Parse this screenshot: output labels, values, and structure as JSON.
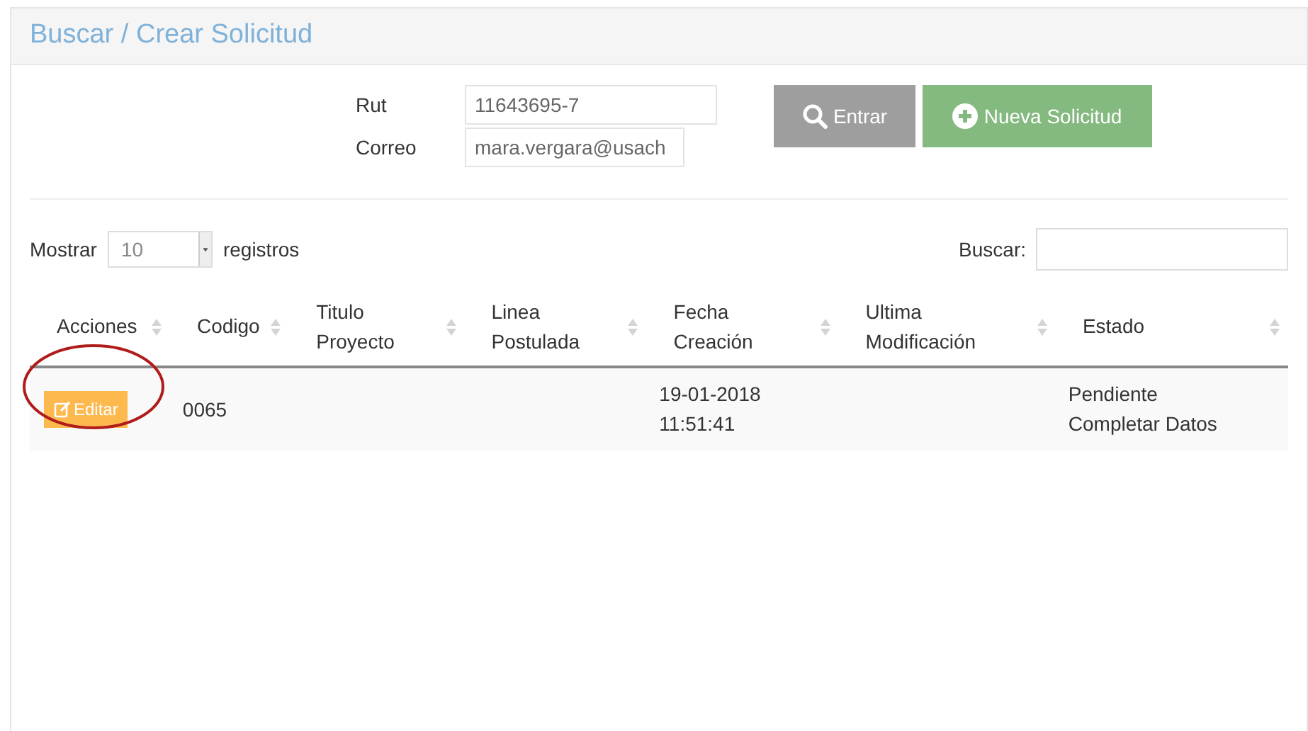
{
  "panel": {
    "title": "Buscar / Crear Solicitud"
  },
  "form": {
    "fields": [
      {
        "label": "Rut",
        "value": "11643695-7"
      },
      {
        "label": "Correo",
        "value": "mara.vergara@usach"
      }
    ],
    "buttons": [
      {
        "kind": "search",
        "label": "Entrar"
      },
      {
        "kind": "add",
        "label": "Nueva Solicitud"
      }
    ]
  },
  "table_controls": {
    "show_label": "Mostrar",
    "page_size": "10",
    "records_label": "registros",
    "search_label": "Buscar:"
  },
  "table": {
    "columns": [
      "Acciones",
      "Codigo",
      "Titulo Proyecto",
      "Linea Postulada",
      "Fecha Creación",
      "Ultima Modificación",
      "Estado"
    ],
    "rows": [
      {
        "highlighted": true,
        "cells": [
          "Editar",
          "0065",
          "",
          "",
          "19-01-2018 11:51:41",
          "",
          "Pendiente Completar Datos"
        ]
      }
    ]
  }
}
